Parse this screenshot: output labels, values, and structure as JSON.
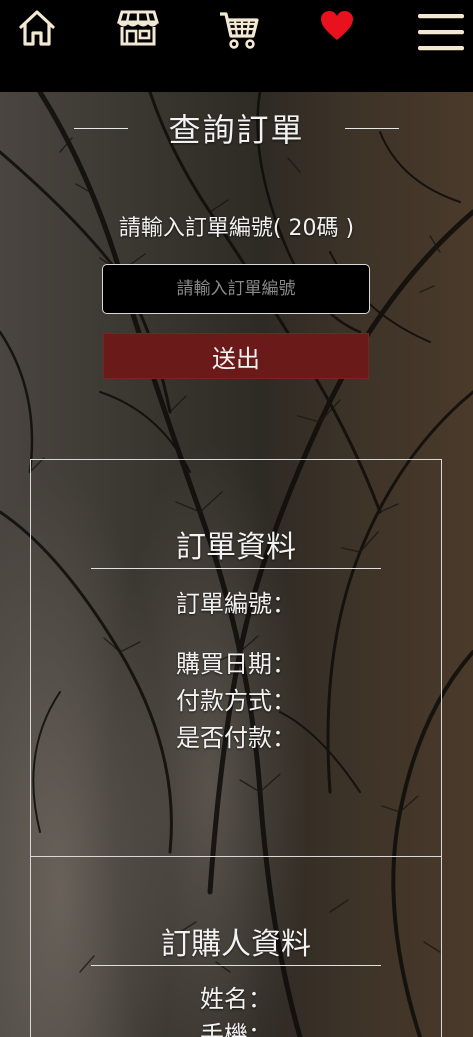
{
  "nav": {
    "icons": [
      "home-icon",
      "store-icon",
      "cart-icon",
      "heart-icon",
      "menu-icon"
    ],
    "heart_color": "#e8121e",
    "icon_color": "#f3e9d2"
  },
  "page": {
    "title": "查詢訂單",
    "instruction": "請輸入訂單編號( 20碼 )",
    "input_placeholder": "請輸入訂單編號",
    "input_value": "",
    "submit_label": "送出",
    "accent": "#6b1a1a"
  },
  "order_info": {
    "title": "訂單資料",
    "order_number_label": "訂單編號：",
    "purchase_date_label": "購買日期：",
    "payment_method_label": "付款方式：",
    "paid_label": "是否付款："
  },
  "buyer_info": {
    "title": "訂購人資料",
    "name_label": "姓名：",
    "phone_label": "手機："
  }
}
